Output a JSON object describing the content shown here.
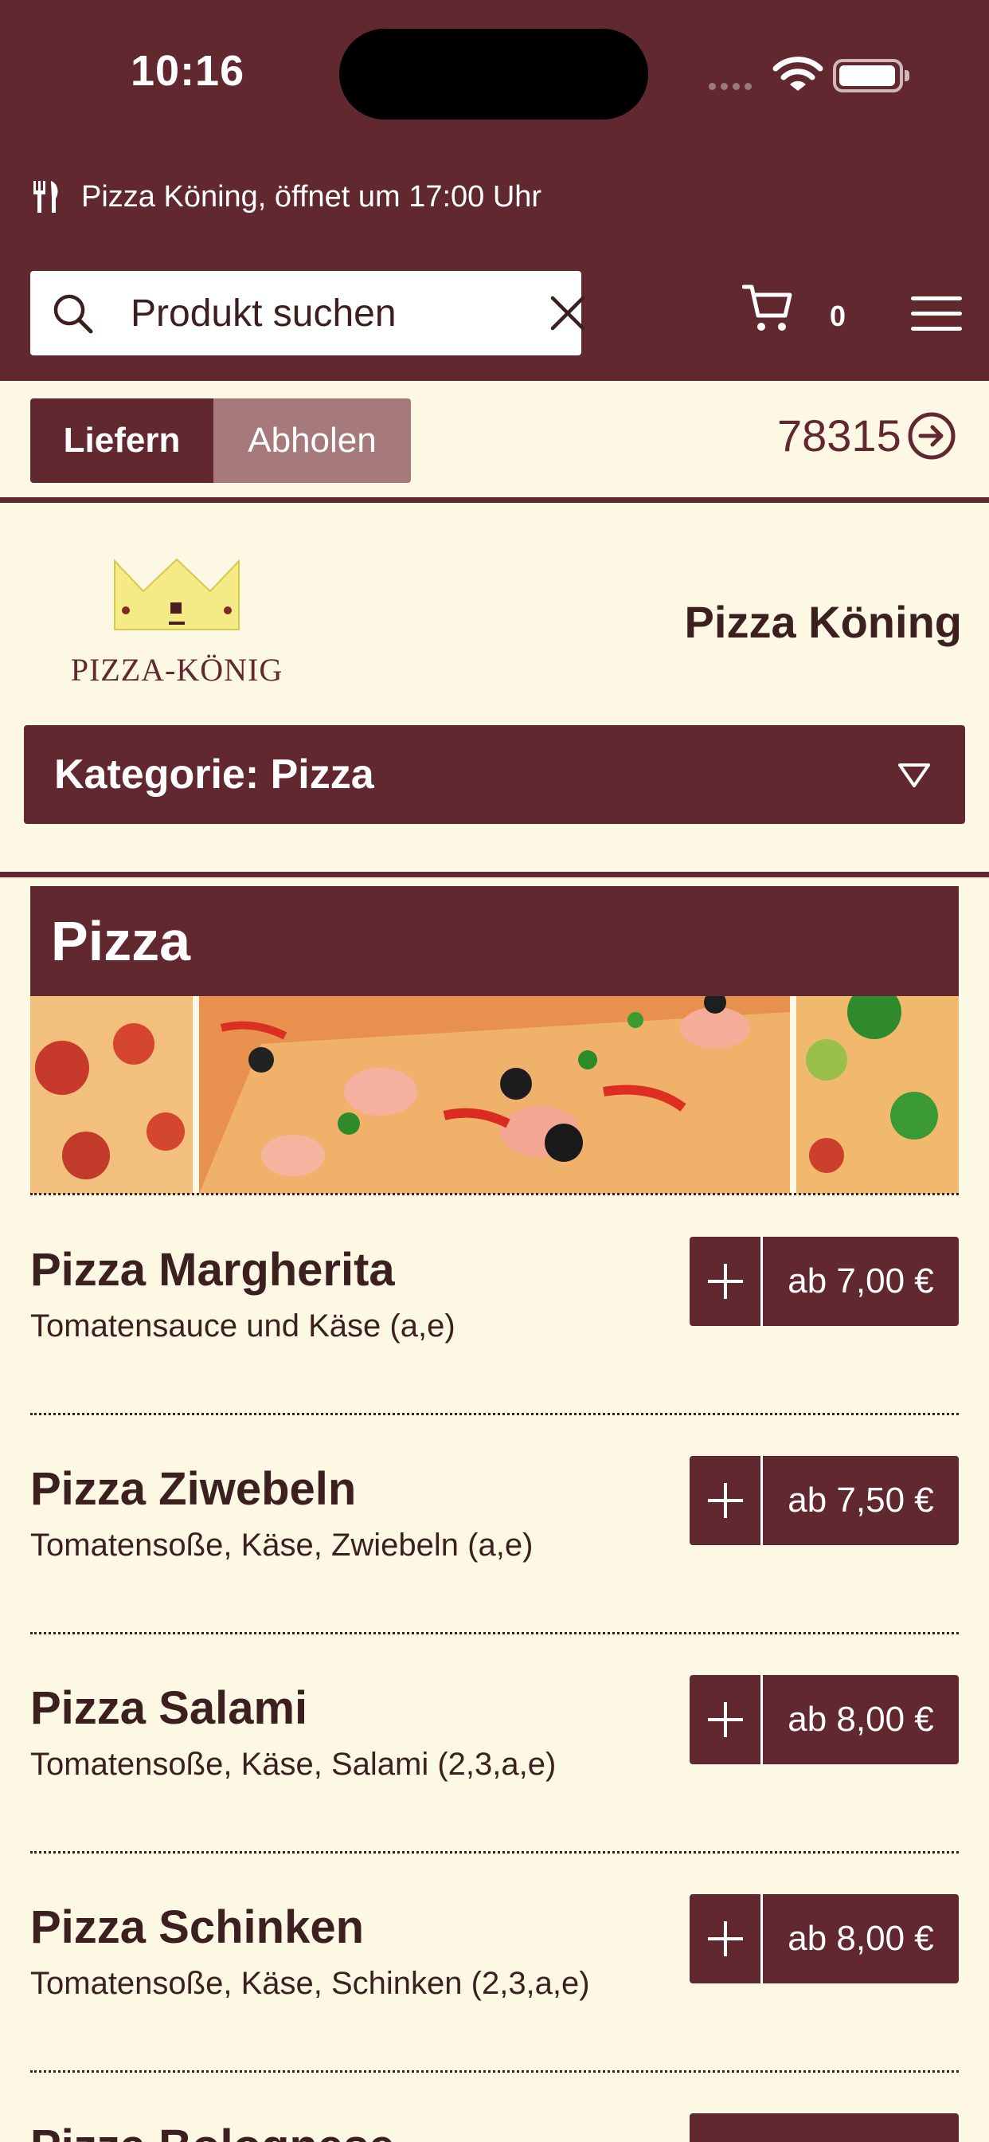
{
  "status_bar": {
    "time": "10:16"
  },
  "header": {
    "shop_status": "Pizza Köning, öffnet um 17:00 Uhr",
    "search": {
      "placeholder": "Produkt suchen",
      "value": ""
    },
    "cart_count": "0",
    "icons": [
      "cutlery-icon",
      "search-icon",
      "close-icon",
      "cart-icon",
      "menu-icon"
    ]
  },
  "order_mode": {
    "deliver_label": "Liefern",
    "pickup_label": "Abholen",
    "selected": "Liefern"
  },
  "zip_code": "78315",
  "restaurant": {
    "name": "Pizza Köning",
    "logo_text": "PIZZA-KÖNIG"
  },
  "category_select": {
    "value": "Kategorie: Pizza"
  },
  "category": {
    "title": "Pizza",
    "products": [
      {
        "name": "Pizza Margherita",
        "description": "Tomatensauce und Käse (a,e)",
        "price": "ab 7,00 €"
      },
      {
        "name": "Pizza Ziwebeln",
        "description": "Tomatensoße, Käse, Zwiebeln (a,e)",
        "price": "ab 7,50 €"
      },
      {
        "name": "Pizza Salami",
        "description": "Tomatensoße, Käse, Salami (2,3,a,e)",
        "price": "ab 8,00 €"
      },
      {
        "name": "Pizza Schinken",
        "description": "Tomatensoße, Käse, Schinken (2,3,a,e)",
        "price": "ab 8,00 €"
      },
      {
        "name": "Pizza Bolognese",
        "description": "",
        "price": ""
      }
    ]
  },
  "colors": {
    "primary": "#612830",
    "background": "#fdf8e4",
    "pickup_inactive": "#a6797b",
    "text": "#3c2020"
  }
}
